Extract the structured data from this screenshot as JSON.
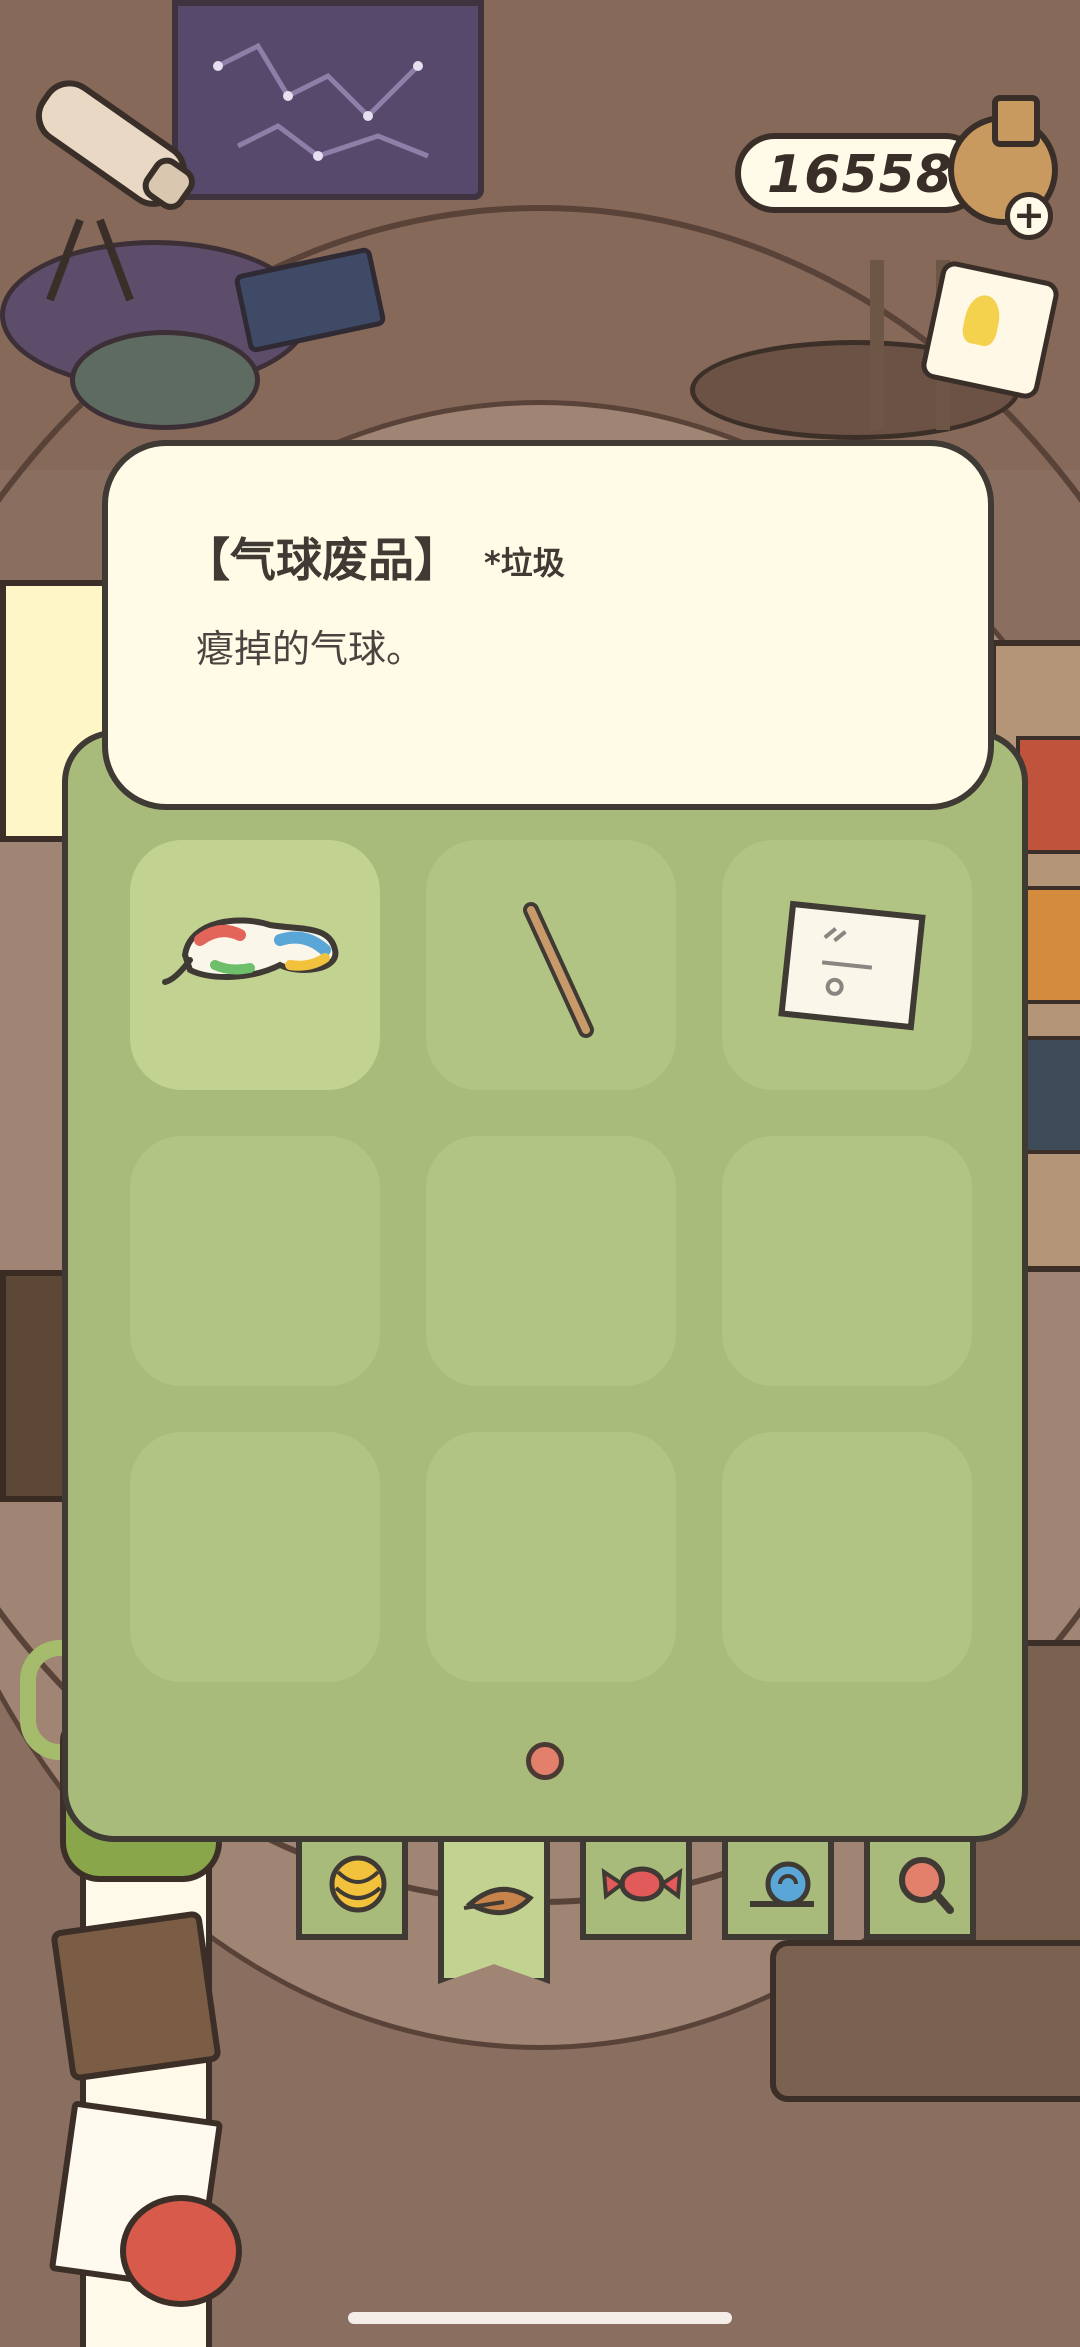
{
  "currency": {
    "amount": "16558",
    "icon": "clover-pot-icon",
    "add_icon": "plus-icon"
  },
  "item_info": {
    "title": "【气球废品】",
    "category": "*垃圾",
    "description": "瘪掉的气球。"
  },
  "inventory": {
    "slots": [
      {
        "item": "deflated-balloon",
        "selected": true
      },
      {
        "item": "wooden-stick",
        "selected": false
      },
      {
        "item": "paper-note",
        "selected": false
      },
      {
        "item": "",
        "selected": false
      },
      {
        "item": "",
        "selected": false
      },
      {
        "item": "",
        "selected": false
      },
      {
        "item": "",
        "selected": false
      },
      {
        "item": "",
        "selected": false
      },
      {
        "item": "",
        "selected": false
      }
    ],
    "page_count": 1,
    "current_page": 1
  },
  "tabs": [
    {
      "name": "yarn-ball",
      "active": false
    },
    {
      "name": "leaf",
      "active": true
    },
    {
      "name": "candy",
      "active": false
    },
    {
      "name": "snail",
      "active": false
    },
    {
      "name": "magnifier",
      "active": false
    }
  ],
  "colors": {
    "panel": "#a9bb7b",
    "slot": "#b2c483",
    "slot_selected": "#c2d290",
    "card": "#fffbe6",
    "outline": "#3f3a34",
    "page_dot": "#e3806c"
  }
}
